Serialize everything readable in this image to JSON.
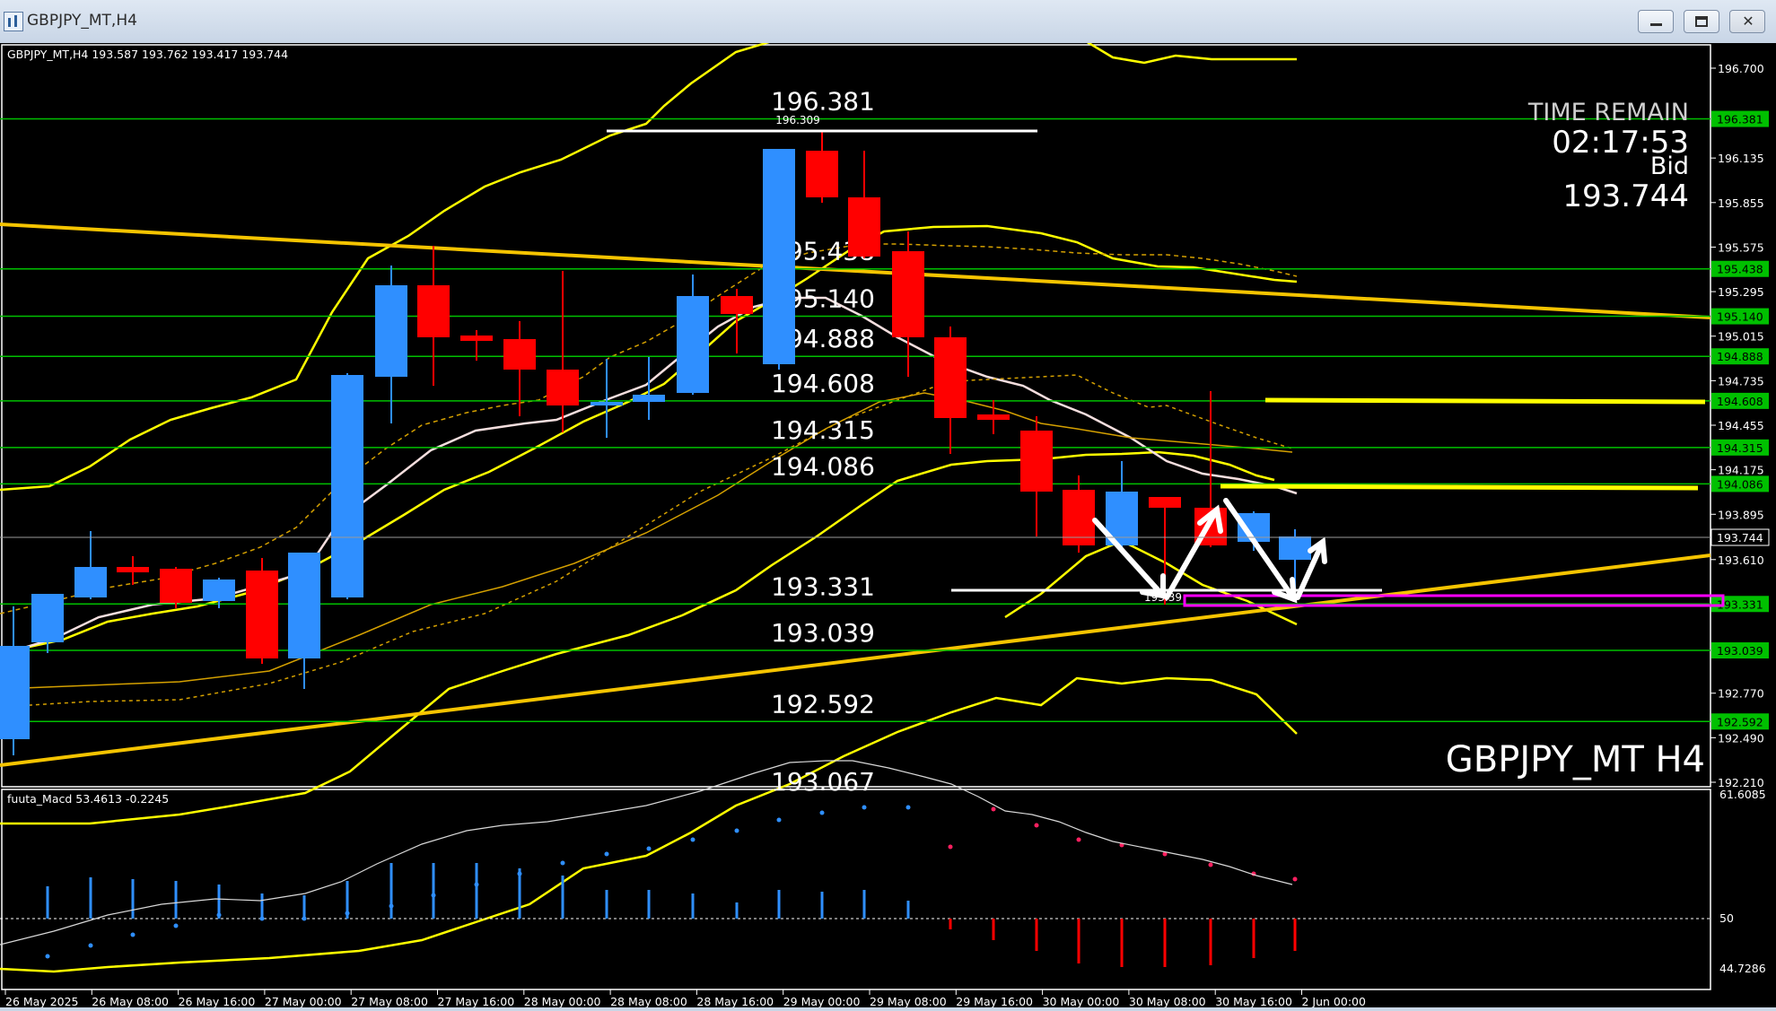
{
  "window": {
    "title": "GBPJPY_MT,H4"
  },
  "chart": {
    "symbol_info": "GBPJPY_MT,H4  193.587 193.762 193.417 193.744",
    "watermark": "GBPJPY_MT H4",
    "time_remain_label": "TIME REMAIN",
    "time_remain_value": "02:17:53",
    "bid_label": "Bid",
    "bid_value": "193.744",
    "high_marker": "196.309",
    "low_marker": "193.39",
    "cut_label": "193.067",
    "price_axis": [
      "196.700",
      "196.135",
      "195.855",
      "195.575",
      "195.295",
      "195.015",
      "194.735",
      "194.455",
      "194.175",
      "193.895",
      "193.610",
      "192.770",
      "192.490",
      "192.210"
    ],
    "level_lines": [
      {
        "value": 196.381,
        "label": "196.381"
      },
      {
        "value": 195.438,
        "label": "195.438"
      },
      {
        "value": 195.14,
        "label": "195.140"
      },
      {
        "value": 194.888,
        "label": "194.888"
      },
      {
        "value": 194.608,
        "label": "194.608"
      },
      {
        "value": 194.315,
        "label": "194.315"
      },
      {
        "value": 194.086,
        "label": "194.086"
      },
      {
        "value": 193.331,
        "label": "193.331"
      },
      {
        "value": 193.039,
        "label": "193.039"
      },
      {
        "value": 192.592,
        "label": "192.592"
      }
    ],
    "current_price_tag": "193.744",
    "time_axis": [
      "26 May 2025",
      "26 May 08:00",
      "26 May 16:00",
      "27 May 00:00",
      "27 May 08:00",
      "27 May 16:00",
      "28 May 00:00",
      "28 May 08:00",
      "28 May 16:00",
      "29 May 00:00",
      "29 May 08:00",
      "29 May 16:00",
      "30 May 00:00",
      "30 May 08:00",
      "30 May 16:00",
      "2 Jun 00:00"
    ],
    "colors": {
      "bull": "#2f8fff",
      "bear": "#ff0000",
      "level": "#00c000",
      "band": "#ffff00",
      "support": "#f5c400",
      "magenta": "#ff00ff"
    }
  },
  "macd": {
    "title": "fuuta_Macd 53.4613  -0.2245",
    "axis": [
      "61.6085",
      "50",
      "44.7286"
    ]
  }
}
